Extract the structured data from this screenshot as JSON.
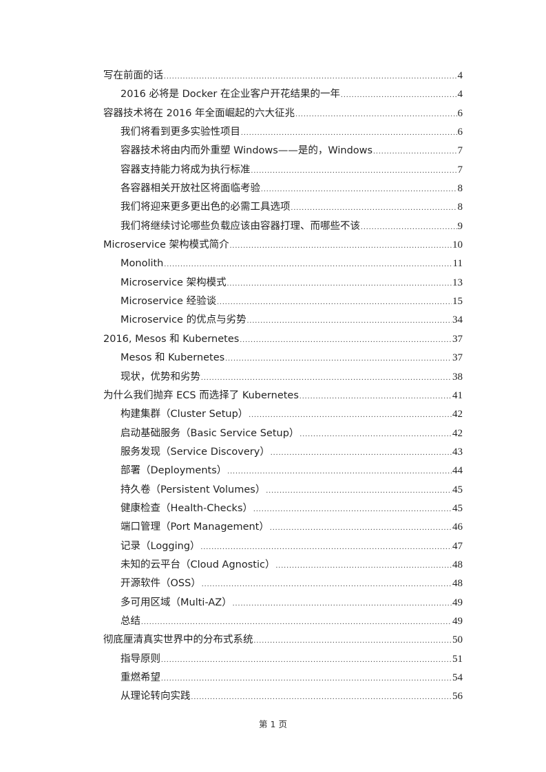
{
  "toc": [
    {
      "level": 1,
      "title": "写在前面的话",
      "page": "4"
    },
    {
      "level": 2,
      "title": "2016 必将是 Docker 在企业客户开花结果的一年",
      "page": "4"
    },
    {
      "level": 1,
      "title": "容器技术将在 2016 年全面崛起的六大征兆",
      "page": "6"
    },
    {
      "level": 2,
      "title": "我们将看到更多实验性项目",
      "page": "6"
    },
    {
      "level": 2,
      "title": "容器技术将由内而外重塑 Windows——是的，Windows",
      "page": "7"
    },
    {
      "level": 2,
      "title": "容器支持能力将成为执行标准",
      "page": "7"
    },
    {
      "level": 2,
      "title": "各容器相关开放社区将面临考验",
      "page": "8"
    },
    {
      "level": 2,
      "title": "我们将迎来更多更出色的必需工具选项",
      "page": "8"
    },
    {
      "level": 2,
      "title": "我们将继续讨论哪些负载应该由容器打理、而哪些不该",
      "page": "9"
    },
    {
      "level": 1,
      "title": "Microservice 架构模式简介",
      "page": "10"
    },
    {
      "level": 2,
      "title": "Monolith",
      "page": "11"
    },
    {
      "level": 2,
      "title": "Microservice 架构模式",
      "page": "13"
    },
    {
      "level": 2,
      "title": "Microservice 经验谈",
      "page": "15"
    },
    {
      "level": 2,
      "title": "Microservice 的优点与劣势",
      "page": "34"
    },
    {
      "level": 1,
      "title": "2016, Mesos 和 Kubernetes",
      "page": "37"
    },
    {
      "level": 2,
      "title": "Mesos 和 Kubernetes",
      "page": "37"
    },
    {
      "level": 2,
      "title": "现状，优势和劣势",
      "page": "38"
    },
    {
      "level": 1,
      "title": "为什么我们抛弃 ECS 而选择了 Kubernetes",
      "page": "41"
    },
    {
      "level": 2,
      "title": "构建集群（Cluster Setup）",
      "page": "42"
    },
    {
      "level": 2,
      "title": "启动基础服务（Basic Service Setup）",
      "page": "42"
    },
    {
      "level": 2,
      "title": "服务发现（Service Discovery）",
      "page": "43"
    },
    {
      "level": 2,
      "title": "部署（Deployments）",
      "page": "44"
    },
    {
      "level": 2,
      "title": "持久卷（Persistent Volumes）",
      "page": "45"
    },
    {
      "level": 2,
      "title": "健康检查（Health-Checks）",
      "page": "45"
    },
    {
      "level": 2,
      "title": "端口管理（Port Management）",
      "page": "46"
    },
    {
      "level": 2,
      "title": "记录（Logging）",
      "page": "47"
    },
    {
      "level": 2,
      "title": "未知的云平台（Cloud Agnostic）",
      "page": "48"
    },
    {
      "level": 2,
      "title": "开源软件（OSS）",
      "page": "48"
    },
    {
      "level": 2,
      "title": "多可用区域（Multi-AZ）",
      "page": "49"
    },
    {
      "level": 2,
      "title": "总结",
      "page": "49"
    },
    {
      "level": 1,
      "title": "彻底厘清真实世界中的分布式系统",
      "page": "50"
    },
    {
      "level": 2,
      "title": "指导原则",
      "page": "51"
    },
    {
      "level": 2,
      "title": "重燃希望",
      "page": "54"
    },
    {
      "level": 2,
      "title": "从理论转向实践",
      "page": "56"
    }
  ],
  "footer": {
    "page_label": "第 1 页"
  }
}
